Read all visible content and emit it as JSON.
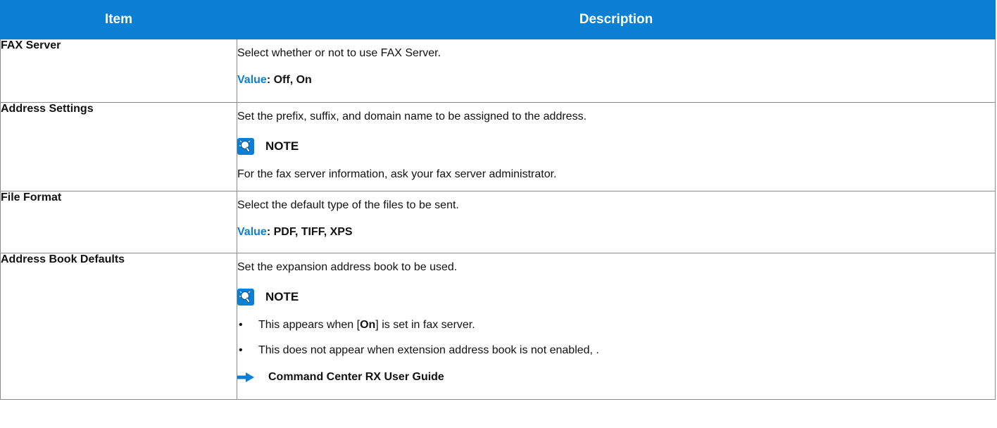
{
  "headers": {
    "item": "Item",
    "description": "Description"
  },
  "colors": {
    "header_bg": "#0a7fd4",
    "value_label": "#0a7fd4",
    "border": "#8a8a8a"
  },
  "rows": [
    {
      "item": "FAX Server",
      "text": "Select whether or not to use FAX Server.",
      "value_label": "Value",
      "value_text": ": Off, On"
    },
    {
      "item": "Address Settings",
      "text": "Set the prefix, suffix, and domain name to be assigned to the address.",
      "note_label": "NOTE",
      "note_icon": "note-lightbulb-icon",
      "note_text": "For the fax server information, ask your fax server administrator."
    },
    {
      "item": "File Format",
      "text": "Select the default type of the files to be sent.",
      "value_label": "Value",
      "value_text": ": PDF, TIFF, XPS"
    },
    {
      "item": "Address Book Defaults",
      "text": "Set the expansion address book to be used.",
      "note_label": "NOTE",
      "note_icon": "note-lightbulb-icon",
      "bullets": [
        {
          "before": "This appears when [",
          "bold": "On",
          "after": "] is set in fax server."
        },
        {
          "text": "This does not appear when extension address book is not enabled, ."
        }
      ],
      "bullet_char": "•",
      "reference": "Command Center RX User Guide",
      "reference_icon": "arrow-right-icon"
    }
  ]
}
